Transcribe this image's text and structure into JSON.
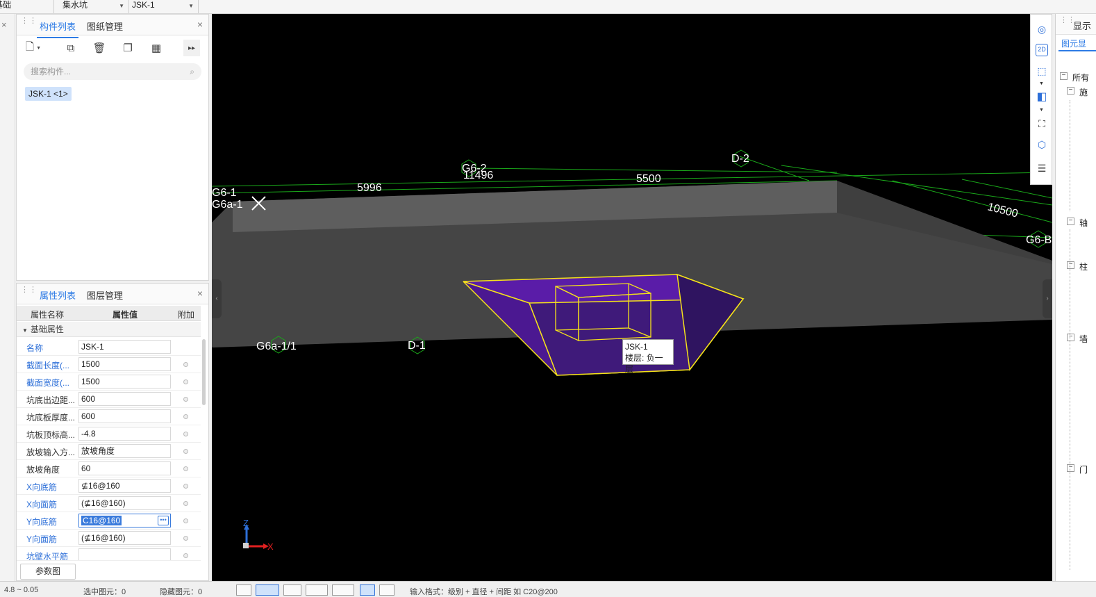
{
  "topbar": {
    "dropdowns": [
      "基础",
      "集水坑",
      "JSK-1"
    ]
  },
  "component_panel": {
    "tabs": [
      "构件列表",
      "图纸管理"
    ],
    "search_placeholder": "搜索构件...",
    "selected_item": "JSK-1 <1>"
  },
  "property_panel": {
    "tabs": [
      "属性列表",
      "图层管理"
    ],
    "columns": [
      "属性名称",
      "属性值",
      "附加"
    ],
    "group_label": "基础属性",
    "rows": [
      {
        "name": "名称",
        "value": "JSK-1"
      },
      {
        "name": "截面长度(...",
        "value": "1500"
      },
      {
        "name": "截面宽度(...",
        "value": "1500"
      },
      {
        "name": "坑底出边距...",
        "value": "600"
      },
      {
        "name": "坑底板厚度...",
        "value": "600"
      },
      {
        "name": "坑板顶标高...",
        "value": "-4.8"
      },
      {
        "name": "放坡输入方...",
        "value": "放坡角度"
      },
      {
        "name": "放坡角度",
        "value": "60"
      },
      {
        "name": "X向底筋",
        "value": "⊈16@160"
      },
      {
        "name": "X向面筋",
        "value": "(⊈16@160)"
      },
      {
        "name": "Y向底筋",
        "value": "C16@160"
      },
      {
        "name": "Y向面筋",
        "value": "(⊈16@160)"
      },
      {
        "name": "坑壁水平筋",
        "value": ""
      }
    ],
    "param_button": "参数图"
  },
  "viewport": {
    "axis_labels": [
      "G6-1",
      "G6a-1",
      "G6-2",
      "D-2",
      "G6-B",
      "G6a-1/1",
      "D-1"
    ],
    "dimensions": [
      "5996",
      "11496",
      "5500",
      "10500"
    ],
    "tooltip_name": "JSK-1",
    "tooltip_floor": "楼层: 负一层",
    "axes": {
      "z": "Z",
      "x": "X"
    }
  },
  "right_toolbar": {
    "icons": [
      "orbit-icon",
      "2d-view-icon",
      "3d-box-icon",
      "3d-solid-icon",
      "fullscreen-icon",
      "view-cube-icon",
      "layer-display-icon"
    ],
    "label_2d": "2D"
  },
  "right_panel": {
    "title": "显示",
    "subtitle": "图元显",
    "tree": [
      {
        "label": "所有",
        "toggle": "−"
      },
      {
        "label": "施",
        "toggle": "−"
      },
      {
        "label": "轴",
        "toggle": "−"
      },
      {
        "label": "柱",
        "toggle": "−"
      },
      {
        "label": "墙",
        "toggle": "−"
      },
      {
        "label": "门",
        "toggle": "−"
      }
    ]
  },
  "statusbar": {
    "coords": "4.8 ~ 0.05",
    "selected_label": "选中图元：0",
    "hidden_label": "隐藏图元：0",
    "hint": "输入格式：级别 + 直径 + 间距 如 C20@200"
  },
  "colors": {
    "viewport_bg": "#000000",
    "slab": "#4a4a4a",
    "pit_fill": "#5a1ca8",
    "pit_edge": "#f5e21a",
    "grid_line": "#1aa81a",
    "accent": "#2d7be5"
  }
}
